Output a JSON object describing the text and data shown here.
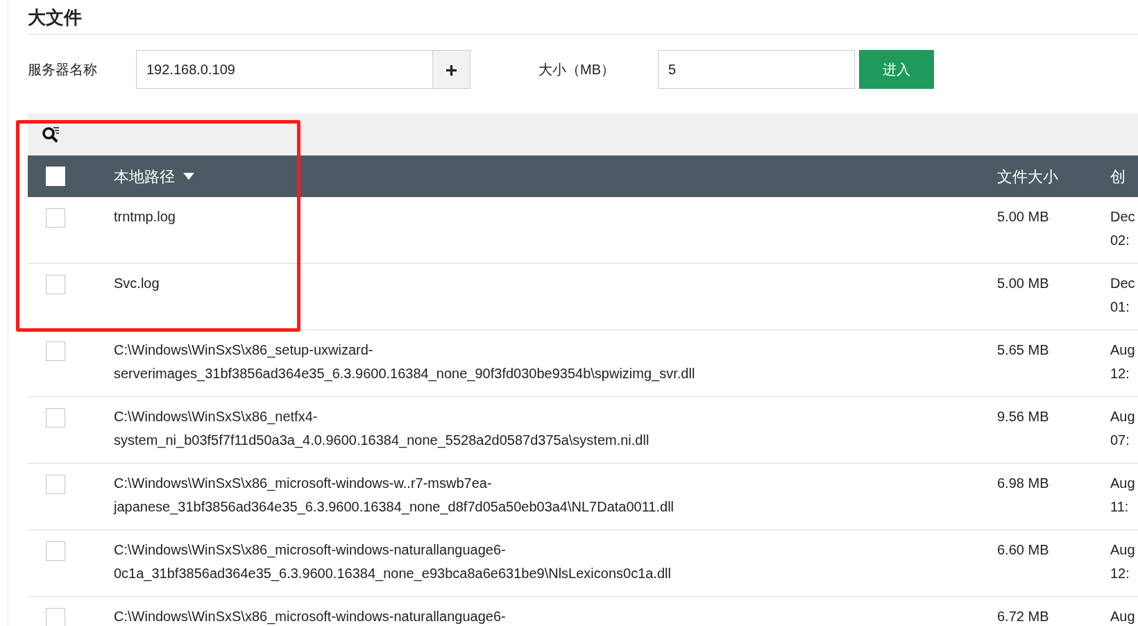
{
  "title": "大文件",
  "form": {
    "server_label": "服务器名称",
    "server_value": "192.168.0.109",
    "add_button": "+",
    "size_label": "大小（MB）",
    "size_value": "5",
    "submit_button": "进入"
  },
  "table": {
    "select_all": {
      "checked": false
    },
    "columns": [
      {
        "label": "本地路径",
        "sorted": true
      },
      {
        "label": "文件大小",
        "sorted": false
      },
      {
        "label": "创",
        "sorted": false
      }
    ],
    "rows": [
      {
        "checked": false,
        "path": [
          "trntmp.log"
        ],
        "size": "5.00 MB",
        "created": [
          "Dec",
          "02:"
        ]
      },
      {
        "checked": false,
        "path": [
          "Svc.log"
        ],
        "size": "5.00 MB",
        "created": [
          "Dec",
          "01:"
        ]
      },
      {
        "checked": false,
        "path": [
          "C:\\Windows\\WinSxS\\x86_setup-uxwizard-",
          "serverimages_31bf3856ad364e35_6.3.9600.16384_none_90f3fd030be9354b\\spwizimg_svr.dll"
        ],
        "size": "5.65 MB",
        "created": [
          "Aug",
          "12:"
        ]
      },
      {
        "checked": false,
        "path": [
          "C:\\Windows\\WinSxS\\x86_netfx4-",
          "system_ni_b03f5f7f11d50a3a_4.0.9600.16384_none_5528a2d0587d375a\\system.ni.dll"
        ],
        "size": "9.56 MB",
        "created": [
          "Aug",
          "07:"
        ]
      },
      {
        "checked": false,
        "path": [
          "C:\\Windows\\WinSxS\\x86_microsoft-windows-w..r7-mswb7ea-",
          "japanese_31bf3856ad364e35_6.3.9600.16384_none_d8f7d05a50eb03a4\\NL7Data0011.dll"
        ],
        "size": "6.98 MB",
        "created": [
          "Aug",
          "11:"
        ]
      },
      {
        "checked": false,
        "path": [
          "C:\\Windows\\WinSxS\\x86_microsoft-windows-naturallanguage6-",
          "0c1a_31bf3856ad364e35_6.3.9600.16384_none_e93bca8a6e631be9\\NlsLexicons0c1a.dll"
        ],
        "size": "6.60 MB",
        "created": [
          "Aug",
          "12:"
        ]
      },
      {
        "checked": false,
        "path": [
          "C:\\Windows\\WinSxS\\x86_microsoft-windows-naturallanguage6-"
        ],
        "size": "6.72 MB",
        "created": [
          "Aug"
        ]
      }
    ]
  }
}
